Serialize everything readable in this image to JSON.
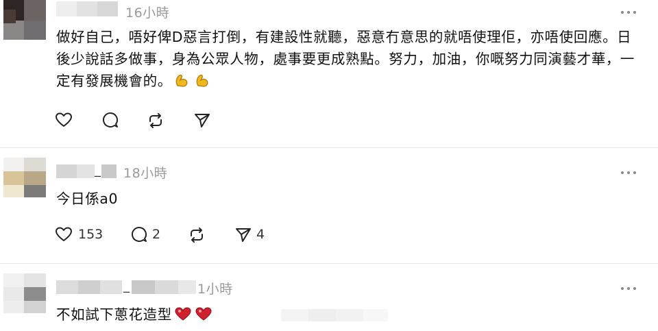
{
  "comments": [
    {
      "time": "16小時",
      "text": "做好自己，唔好俾D惡言打倒，有建設性就聽，惡意冇意思的就唔使理佢，亦唔使回應。日後少說話多做事，身為公眾人物，處事要更成熟點。努力，加油，你嘅努力同演藝才華，一定有發展機會的。",
      "emoji_icons": [
        "flexed-biceps-icon",
        "flexed-biceps-icon"
      ],
      "likes": "",
      "replies": "",
      "reposts": "",
      "shares": ""
    },
    {
      "username_visible": "_",
      "time": "18小時",
      "text": "今日係a0",
      "likes": "153",
      "replies": "2",
      "reposts": "",
      "shares": "4"
    },
    {
      "username_visible": "_",
      "time": "1小時",
      "text": "不如試下蔥花造型",
      "emoji_icons": [
        "heart-exclamation-icon",
        "heart-exclamation-icon"
      ],
      "likes": "",
      "replies": "",
      "reposts": "",
      "shares": ""
    }
  ],
  "colors": {
    "time_gray": "#999999",
    "icon_stroke": "#222222",
    "divider": "#e6e6e6",
    "emoji_gold": "#f2b81f",
    "heart_red": "#d0202f"
  }
}
